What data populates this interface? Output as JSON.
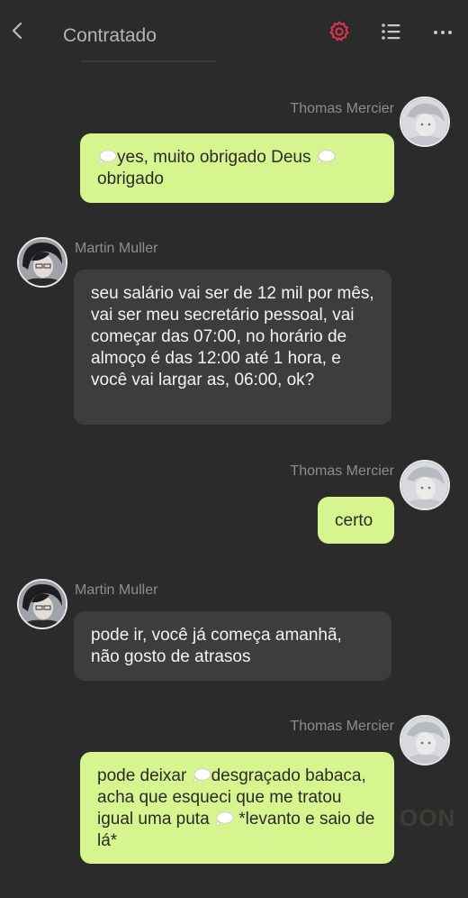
{
  "header": {
    "title": "Contratado",
    "icons": [
      "back-icon",
      "gear-icon",
      "list-icon",
      "more-icon"
    ],
    "accent_color": "#e0344b"
  },
  "messages": [
    {
      "sender": "Thomas Mercier",
      "side": "right",
      "text_before": "",
      "text_a": "yes, muito obrigado Deus ",
      "text_b": " obrigado",
      "text_c": ""
    },
    {
      "sender": "Martin Muller",
      "side": "left",
      "text": "seu salário vai ser de 12 mil por mês, vai ser meu secretário pessoal, vai começar das 07:00, no horário de almoço é das 12:00 até 1 hora, e você vai largar as, 06:00, ok?"
    },
    {
      "sender": "Thomas Mercier",
      "side": "right",
      "text": "certo"
    },
    {
      "sender": "Martin Muller",
      "side": "left",
      "text": "pode ir, você já começa amanhã, não gosto de atrasos"
    },
    {
      "sender": "Thomas Mercier",
      "side": "right",
      "text_a": "pode deixar ",
      "text_b": "desgraçado babaca, acha que esqueci que me tratou igual uma puta ",
      "text_c": " *levanto e saio de lá*"
    }
  ],
  "watermark": "OON",
  "colors": {
    "my_bubble": "#d7f58f",
    "other_bubble": "#3d3d3d",
    "background": "#2b2b2b"
  }
}
